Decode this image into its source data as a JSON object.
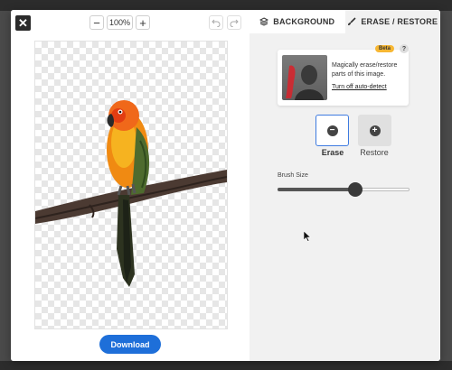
{
  "toolbar": {
    "close_label": "✕",
    "zoom_out_label": "−",
    "zoom_value": "100%",
    "zoom_in_label": "+",
    "undo_icon": "undo-icon",
    "redo_icon": "redo-icon"
  },
  "canvas": {
    "background": "transparent-checkerboard",
    "subject": "parrot-on-branch"
  },
  "download_label": "Download",
  "tabs": [
    {
      "label": "BACKGROUND",
      "icon": "layers-icon"
    },
    {
      "label": "ERASE / RESTORE",
      "icon": "brush-icon"
    }
  ],
  "info_card": {
    "badge": "Beta",
    "help": "?",
    "text": "Magically erase/restore parts of this image.",
    "link": "Turn off auto-detect"
  },
  "modes": {
    "erase_label": "Erase",
    "restore_label": "Restore",
    "selected": "Erase"
  },
  "brush": {
    "label": "Brush Size",
    "value_fraction": 0.59
  },
  "colors": {
    "accent": "#1e6fd9",
    "selected_border": "#3e7be0",
    "beta_badge": "#f7b733"
  }
}
